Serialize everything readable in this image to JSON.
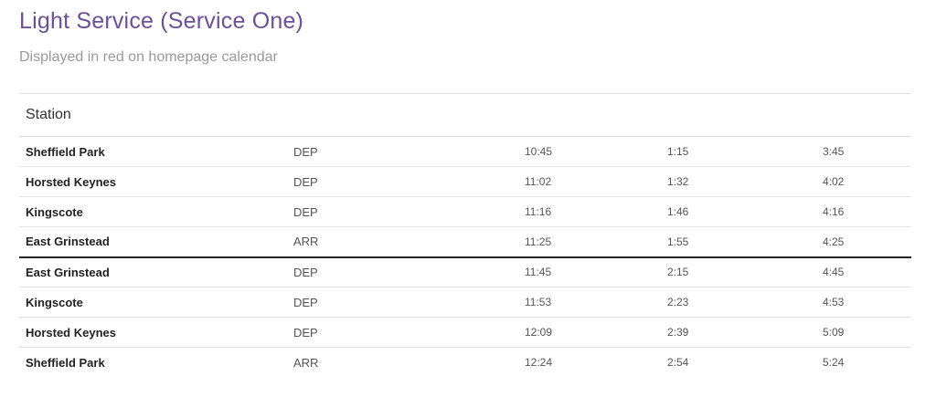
{
  "header": {
    "title": "Light Service (Service One)",
    "subtitle": "Displayed in red on homepage calendar"
  },
  "timetable": {
    "columns": {
      "station": "Station"
    },
    "rows": [
      {
        "station": "Sheffield Park",
        "type": "DEP",
        "times": [
          "10:45",
          "1:15",
          "3:45"
        ]
      },
      {
        "station": "Horsted Keynes",
        "type": "DEP",
        "times": [
          "11:02",
          "1:32",
          "4:02"
        ]
      },
      {
        "station": "Kingscote",
        "type": "DEP",
        "times": [
          "11:16",
          "1:46",
          "4:16"
        ]
      },
      {
        "station": "East Grinstead",
        "type": "ARR",
        "times": [
          "11:25",
          "1:55",
          "4:25"
        ]
      },
      {
        "station": "East Grinstead",
        "type": "DEP",
        "times": [
          "11:45",
          "2:15",
          "4:45"
        ]
      },
      {
        "station": "Kingscote",
        "type": "DEP",
        "times": [
          "11:53",
          "2:23",
          "4:53"
        ]
      },
      {
        "station": "Horsted Keynes",
        "type": "DEP",
        "times": [
          "12:09",
          "2:39",
          "5:09"
        ]
      },
      {
        "station": "Sheffield Park",
        "type": "ARR",
        "times": [
          "12:24",
          "2:54",
          "5:24"
        ]
      }
    ]
  },
  "colors": {
    "title": "#6e4f9a",
    "subtitle": "#9a9a9a",
    "divider": "#222222"
  }
}
